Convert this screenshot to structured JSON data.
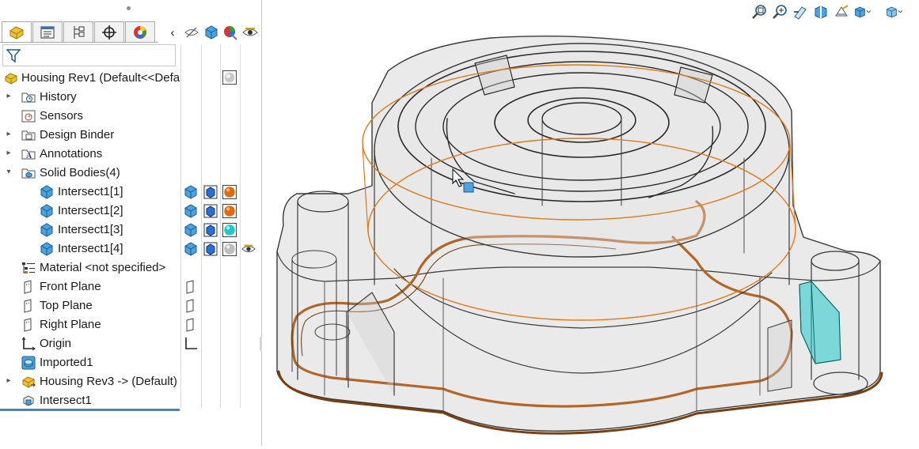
{
  "tree": {
    "root": "Housing Rev1  (Default<<Defa",
    "items": [
      {
        "label": "History",
        "icon": "history-folder-icon"
      },
      {
        "label": "Sensors",
        "icon": "sensors-icon"
      },
      {
        "label": "Design Binder",
        "icon": "design-binder-icon"
      },
      {
        "label": "Annotations",
        "icon": "annotations-icon"
      },
      {
        "label": "Solid Bodies(4)",
        "icon": "solid-bodies-folder-icon"
      },
      {
        "label": "Intersect1[1]",
        "icon": "solid-body-icon",
        "appearance": "#e06a10"
      },
      {
        "label": "Intersect1[2]",
        "icon": "solid-body-icon",
        "appearance": "#e06a10"
      },
      {
        "label": "Intersect1[3]",
        "icon": "solid-body-icon",
        "appearance": "#20c8c8"
      },
      {
        "label": "Intersect1[4]",
        "icon": "solid-body-icon",
        "appearance": "#bdbdbd"
      },
      {
        "label": "Material <not specified>",
        "icon": "material-icon"
      },
      {
        "label": "Front Plane",
        "icon": "plane-icon"
      },
      {
        "label": "Top Plane",
        "icon": "plane-icon"
      },
      {
        "label": "Right Plane",
        "icon": "plane-icon"
      },
      {
        "label": "Origin",
        "icon": "origin-icon"
      },
      {
        "label": "Imported1",
        "icon": "imported-body-icon"
      },
      {
        "label": "Housing Rev3 -> (Default)",
        "icon": "part-reference-icon"
      },
      {
        "label": "Intersect1",
        "icon": "intersect-feature-icon"
      }
    ]
  },
  "tabs": [
    "feature-manager",
    "property-manager",
    "configuration-manager",
    "dimxpert-manager",
    "display-manager"
  ],
  "colors": {
    "accent": "#3c86c6",
    "body_orange": "#e06a10",
    "body_cyan": "#20c8c8",
    "body_gray": "#bdbdbd",
    "model_edge": "#3a3a3a",
    "model_fill": "#d9d9d9",
    "intersect_curve": "#e07a1a",
    "groove": "#a0522d"
  },
  "hud_icons": [
    "zoom-to-fit-icon",
    "zoom-to-area-icon",
    "previous-view-icon",
    "section-view-icon",
    "dynamic-annotation-icon",
    "view-orientation-icon",
    "display-style-icon"
  ]
}
